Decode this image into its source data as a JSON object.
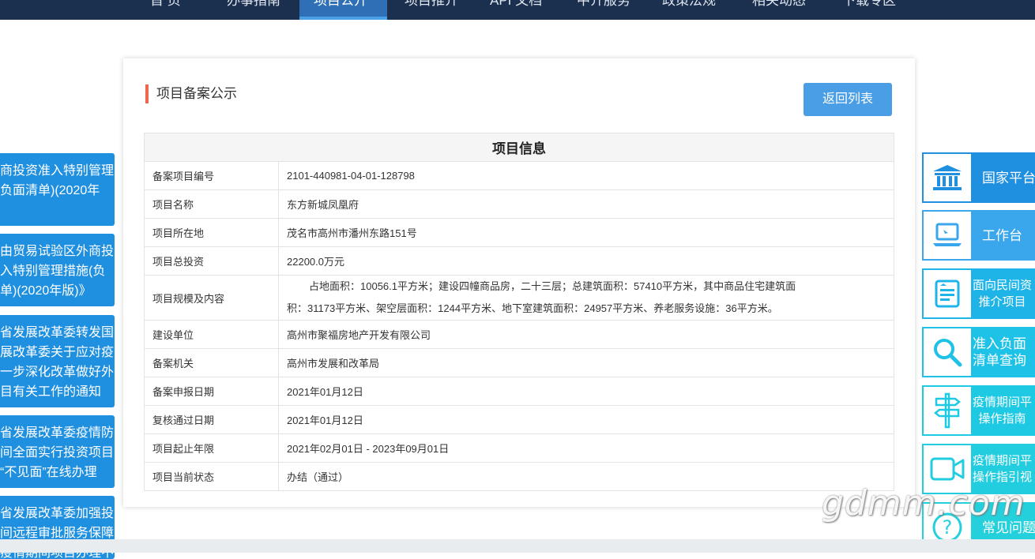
{
  "topnav": {
    "items": [
      "首 页",
      "办事指南",
      "项目公开",
      "项目推介",
      "API 文档",
      "中介服务",
      "政策法规",
      "相关动态",
      "下载专区"
    ],
    "active_index": 2
  },
  "left_notices": [
    {
      "lines": [
        "商投资准入特别管理",
        "负面清单)(2020年"
      ]
    },
    {
      "lines": [
        "由贸易试验区外商投",
        "入特别管理措施(负",
        "单)(2020年版)》"
      ]
    },
    {
      "lines": [
        "省发展改革委转发国",
        "展改革委关于应对疫",
        "一步深化改革做好外",
        "目有关工作的通知"
      ]
    },
    {
      "lines": [
        "省发展改革委疫情防",
        "间全面实行投资项目",
        "“不见面”在线办理"
      ]
    },
    {
      "lines": [
        "省发展改革委加强投",
        "间远程审批服务保障",
        "疫情期间项目办理不"
      ]
    }
  ],
  "card": {
    "title": "项目备案公示",
    "back_button": "返回列表",
    "table_title": "项目信息",
    "rows": [
      {
        "label": "备案项目编号",
        "value": "2101-440981-04-01-128798"
      },
      {
        "label": "项目名称",
        "value": "东方新城凤凰府"
      },
      {
        "label": "项目所在地",
        "value": "茂名市高州市潘州东路151号"
      },
      {
        "label": "项目总投资",
        "value": "22200.0万元"
      },
      {
        "label": "项目规模及内容",
        "value_line1": "占地面积：10056.1平方米；建设四幢商品房，二十三层；总建筑面积：57410平方米，其中商品住宅建筑面",
        "value_line2": "积：31173平方米、架空层面积：1244平方米、地下室建筑面积：24957平方米、养老服务设施：36平方米。"
      },
      {
        "label": "建设单位",
        "value": "高州市聚福房地产开发有限公司"
      },
      {
        "label": "备案机关",
        "value": "高州市发展和改革局"
      },
      {
        "label": "备案申报日期",
        "value": "2021年01月12日"
      },
      {
        "label": "复核通过日期",
        "value": "2021年01月12日"
      },
      {
        "label": "项目起止年限",
        "value": "2021年02月01日 - 2023年09月01日"
      },
      {
        "label": "项目当前状态",
        "value": "办结（通过）"
      }
    ]
  },
  "right_panel": [
    {
      "icon": "bank-building-icon",
      "text": "国家平台",
      "color": "#1f8fe0"
    },
    {
      "icon": "laptop-icon",
      "text": "工作台",
      "color": "#3aa6ec"
    },
    {
      "icon": "document-list-icon",
      "line1": "面向民间资",
      "line2": "推介项目",
      "color": "#1fb4e8"
    },
    {
      "icon": "magnifier-icon",
      "line1": "准入负面",
      "line2": "清单查询",
      "color": "#1ec2e6"
    },
    {
      "icon": "signpost-icon",
      "line1": "疫情期间平",
      "line2": "操作指南",
      "color": "#1ec9e4"
    },
    {
      "icon": "video-camera-icon",
      "line1": "疫情期间平",
      "line2": "操作指引视",
      "color": "#22cde0"
    },
    {
      "icon": "question-icon",
      "text": "常见问题",
      "color": "#24d0dc"
    }
  ],
  "watermark": "gdmm.com"
}
